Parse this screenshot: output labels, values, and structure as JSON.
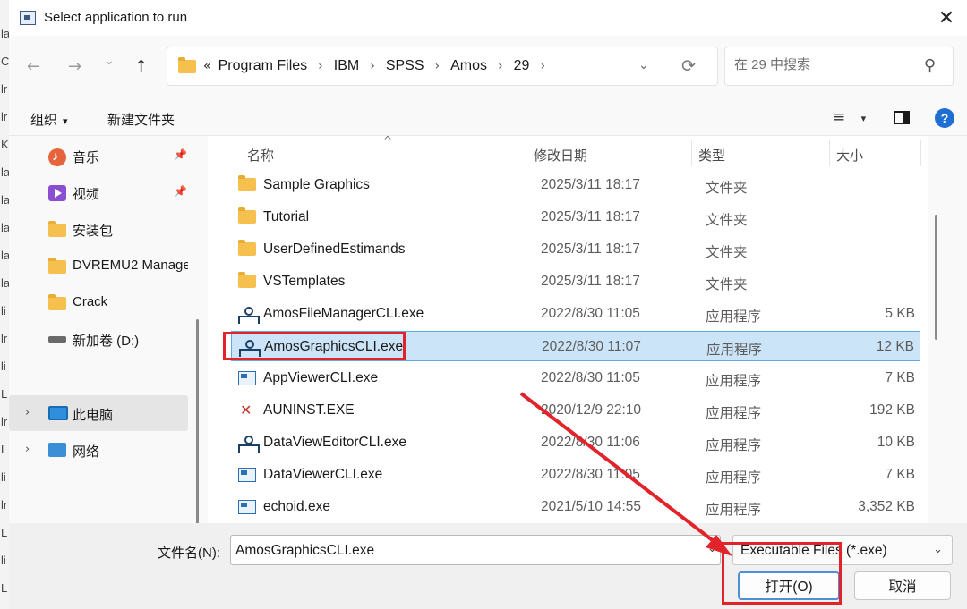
{
  "window": {
    "title": "Select application to run",
    "close_glyph": "✕"
  },
  "background_strip": [
    "la",
    "C",
    "lr",
    "lr",
    "K",
    "la",
    "la",
    "la",
    "la",
    "la",
    "li",
    "lr",
    "li",
    "L",
    "lr",
    "L",
    "li",
    "lr",
    "L",
    "li",
    "L"
  ],
  "nav": {
    "back": "←",
    "forward": "→",
    "recent": "⌄",
    "up": "↑"
  },
  "address": {
    "overflow": "«",
    "crumbs": [
      "Program Files",
      "IBM",
      "SPSS",
      "Amos",
      "29"
    ],
    "separator": "›",
    "dropdown": "⌄",
    "refresh": "⟳"
  },
  "search": {
    "placeholder": "在 29 中搜索",
    "icon": "⚲"
  },
  "toolbar": {
    "organize": "组织",
    "new_folder": "新建文件夹",
    "view_glyph": "≡",
    "caret": "▾",
    "help": "?"
  },
  "sidebar": {
    "items": [
      {
        "label": "音乐",
        "icon": "music-icon",
        "pinned": true
      },
      {
        "label": "视频",
        "icon": "video-icon",
        "pinned": true
      },
      {
        "label": "安装包",
        "icon": "folder-icon"
      },
      {
        "label": "DVREMU2 Manager",
        "icon": "folder-icon"
      },
      {
        "label": "Crack",
        "icon": "folder-icon"
      },
      {
        "label": "新加卷 (D:)",
        "icon": "drive-icon"
      },
      {
        "label": "此电脑",
        "icon": "pc-icon"
      },
      {
        "label": "网络",
        "icon": "network-icon"
      }
    ],
    "pin_glyph": "📌",
    "expand_glyph": "›"
  },
  "columns": {
    "name": "名称",
    "modified": "修改日期",
    "type": "类型",
    "size": "大小",
    "sort": "^"
  },
  "files": [
    {
      "name": "Sample Graphics",
      "modified": "2025/3/11 18:17",
      "type": "文件夹",
      "size": "",
      "icon": "folder-icon"
    },
    {
      "name": "Tutorial",
      "modified": "2025/3/11 18:17",
      "type": "文件夹",
      "size": "",
      "icon": "folder-icon"
    },
    {
      "name": "UserDefinedEstimands",
      "modified": "2025/3/11 18:17",
      "type": "文件夹",
      "size": "",
      "icon": "folder-icon"
    },
    {
      "name": "VSTemplates",
      "modified": "2025/3/11 18:17",
      "type": "文件夹",
      "size": "",
      "icon": "folder-icon"
    },
    {
      "name": "AmosFileManagerCLI.exe",
      "modified": "2022/8/30 11:05",
      "type": "应用程序",
      "size": "5 KB",
      "icon": "tree-icon"
    },
    {
      "name": "AmosGraphicsCLI.exe",
      "modified": "2022/8/30 11:07",
      "type": "应用程序",
      "size": "12 KB",
      "icon": "tree-icon",
      "selected": true
    },
    {
      "name": "AppViewerCLI.exe",
      "modified": "2022/8/30 11:05",
      "type": "应用程序",
      "size": "7 KB",
      "icon": "app-icon"
    },
    {
      "name": "AUNINST.EXE",
      "modified": "2020/12/9 22:10",
      "type": "应用程序",
      "size": "192 KB",
      "icon": "uninstall-icon"
    },
    {
      "name": "DataViewEditorCLI.exe",
      "modified": "2022/8/30 11:06",
      "type": "应用程序",
      "size": "10 KB",
      "icon": "tree-icon"
    },
    {
      "name": "DataViewerCLI.exe",
      "modified": "2022/8/30 11:05",
      "type": "应用程序",
      "size": "7 KB",
      "icon": "app-icon"
    },
    {
      "name": "echoid.exe",
      "modified": "2021/5/10 14:55",
      "type": "应用程序",
      "size": "3,352 KB",
      "icon": "app-icon"
    }
  ],
  "footer": {
    "filename_label": "文件名(N):",
    "filename_value": "AmosGraphicsCLI.exe",
    "filename_dropdown": "⌄",
    "filetype_value": "Executable Files (*.exe)",
    "filetype_dropdown": "⌄",
    "open_label": "打开(O)",
    "cancel_label": "取消"
  },
  "colors": {
    "annotation": "#e2232a",
    "selection": "#cce4f7",
    "accent": "#1f6fd2"
  }
}
